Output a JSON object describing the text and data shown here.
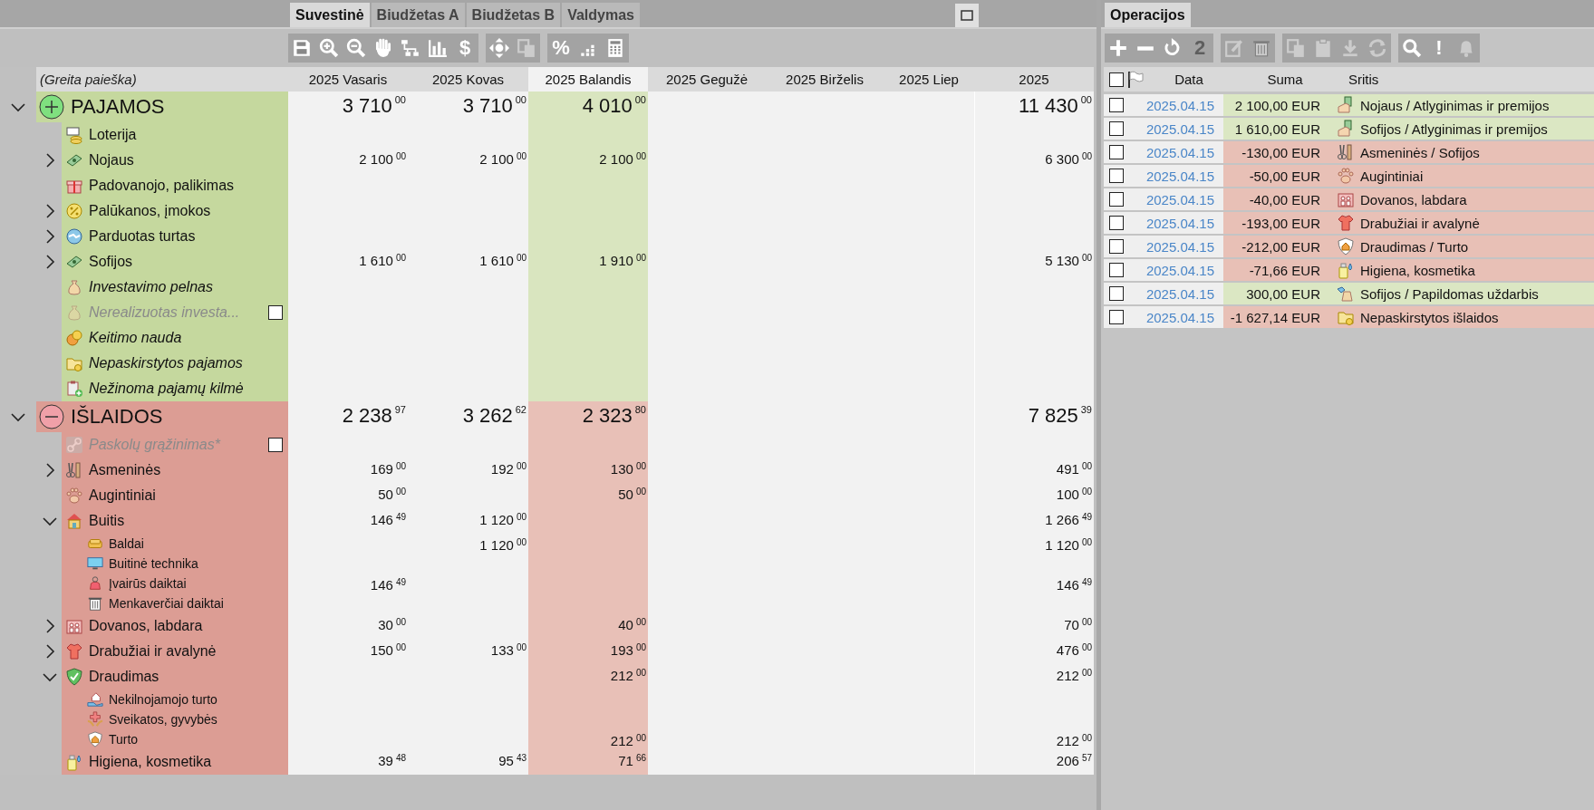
{
  "left_tabs": [
    {
      "label": "Suvestinė",
      "selected": true
    },
    {
      "label": "Biudžetas A",
      "selected": false
    },
    {
      "label": "Biudžetas B",
      "selected": false
    },
    {
      "label": "Valdymas",
      "selected": false
    }
  ],
  "toolbar": [
    [
      {
        "disabled": false
      },
      {
        "disabled": false
      },
      {
        "disabled": false
      },
      {
        "disabled": false
      },
      {
        "disabled": false
      },
      {
        "disabled": false
      },
      {
        "label": "$",
        "disabled": false
      }
    ],
    [
      {
        "disabled": false
      },
      {
        "disabled": true
      }
    ],
    [
      {
        "label": "%",
        "disabled": false
      },
      {
        "disabled": false
      },
      {
        "disabled": false
      }
    ]
  ],
  "tree": {
    "search": {
      "placeholder": "(Greita paieška)"
    },
    "columns": [
      {
        "label": "2025 Vasaris",
        "selected": false
      },
      {
        "label": "2025 Kovas",
        "selected": false
      },
      {
        "label": "2025 Balandis",
        "selected": true
      },
      {
        "label": "2025 Gegužė",
        "selected": false
      },
      {
        "label": "2025 Birželis",
        "selected": false
      },
      {
        "label": "2025 Liep",
        "selected": false
      },
      {
        "label": "2025",
        "selected": false
      }
    ],
    "sections": [
      {
        "label": "PAJAMOS",
        "kind": "income",
        "expanded": true,
        "values": {
          "vasaris": [
            "3 710",
            "00"
          ],
          "kovas": [
            "3 710",
            "00"
          ],
          "balandis": [
            "4 010",
            "00"
          ],
          "year": [
            "11 430",
            "00"
          ]
        },
        "children": [
          {
            "label": "Loterija",
            "italic": false,
            "disabled": false
          },
          {
            "label": "Nojaus",
            "expanded": false,
            "italic": false,
            "disabled": false,
            "values": {
              "vasaris": [
                "2 100",
                "00"
              ],
              "kovas": [
                "2 100",
                "00"
              ],
              "balandis": [
                "2 100",
                "00"
              ],
              "year": [
                "6 300",
                "00"
              ]
            }
          },
          {
            "label": "Padovanojo, palikimas",
            "italic": false,
            "disabled": false
          },
          {
            "label": "Palūkanos, įmokos",
            "expanded": false,
            "italic": false,
            "disabled": false
          },
          {
            "label": "Parduotas turtas",
            "expanded": false,
            "italic": false,
            "disabled": false
          },
          {
            "label": "Sofijos",
            "expanded": false,
            "italic": false,
            "disabled": false,
            "values": {
              "vasaris": [
                "1 610",
                "00"
              ],
              "kovas": [
                "1 610",
                "00"
              ],
              "balandis": [
                "1 910",
                "00"
              ],
              "year": [
                "5 130",
                "00"
              ]
            }
          },
          {
            "label": "Investavimo pelnas",
            "italic": true,
            "disabled": false
          },
          {
            "label": "Nerealizuotas investa...",
            "italic": true,
            "disabled": true,
            "checked": false
          },
          {
            "label": "Keitimo nauda",
            "italic": true,
            "disabled": false
          },
          {
            "label": "Nepaskirstytos pajamos",
            "italic": true,
            "disabled": false
          },
          {
            "label": "Nežinoma pajamų kilmė",
            "italic": true,
            "disabled": false
          }
        ]
      },
      {
        "label": "IŠLAIDOS",
        "kind": "expense",
        "expanded": true,
        "values": {
          "vasaris": [
            "2 238",
            "97"
          ],
          "kovas": [
            "3 262",
            "62"
          ],
          "balandis": [
            "2 323",
            "80"
          ],
          "year": [
            "7 825",
            "39"
          ]
        },
        "children": [
          {
            "label": "Paskolų grąžinimas*",
            "italic": true,
            "disabled": true,
            "checked": false
          },
          {
            "label": "Asmeninės",
            "expanded": false,
            "italic": false,
            "disabled": false,
            "values": {
              "vasaris": [
                "169",
                "00"
              ],
              "kovas": [
                "192",
                "00"
              ],
              "balandis": [
                "130",
                "00"
              ],
              "year": [
                "491",
                "00"
              ]
            }
          },
          {
            "label": "Augintiniai",
            "italic": false,
            "disabled": false,
            "values": {
              "vasaris": [
                "50",
                "00"
              ],
              "balandis": [
                "50",
                "00"
              ],
              "year": [
                "100",
                "00"
              ]
            }
          },
          {
            "label": "Buitis",
            "expanded": true,
            "italic": false,
            "disabled": false,
            "values": {
              "vasaris": [
                "146",
                "49"
              ],
              "kovas": [
                "1 120",
                "00"
              ],
              "year": [
                "1 266",
                "49"
              ]
            },
            "children": [
              {
                "label": "Baldai",
                "values": {
                  "kovas": [
                    "1 120",
                    "00"
                  ],
                  "year": [
                    "1 120",
                    "00"
                  ]
                }
              },
              {
                "label": "Buitinė technika"
              },
              {
                "label": "Įvairūs daiktai",
                "values": {
                  "vasaris": [
                    "146",
                    "49"
                  ],
                  "year": [
                    "146",
                    "49"
                  ]
                }
              },
              {
                "label": "Menkaverčiai daiktai"
              }
            ]
          },
          {
            "label": "Dovanos, labdara",
            "expanded": false,
            "italic": false,
            "disabled": false,
            "values": {
              "vasaris": [
                "30",
                "00"
              ],
              "balandis": [
                "40",
                "00"
              ],
              "year": [
                "70",
                "00"
              ]
            }
          },
          {
            "label": "Drabužiai ir avalynė",
            "expanded": false,
            "italic": false,
            "disabled": false,
            "values": {
              "vasaris": [
                "150",
                "00"
              ],
              "kovas": [
                "133",
                "00"
              ],
              "balandis": [
                "193",
                "00"
              ],
              "year": [
                "476",
                "00"
              ]
            }
          },
          {
            "label": "Draudimas",
            "expanded": true,
            "italic": false,
            "disabled": false,
            "values": {
              "balandis": [
                "212",
                "00"
              ],
              "year": [
                "212",
                "00"
              ]
            },
            "children": [
              {
                "label": "Nekilnojamojo turto"
              },
              {
                "label": "Sveikatos, gyvybės"
              },
              {
                "label": "Turto",
                "values": {
                  "balandis": [
                    "212",
                    "00"
                  ],
                  "year": [
                    "212",
                    "00"
                  ]
                }
              }
            ]
          },
          {
            "label": "Higiena, kosmetika",
            "italic": false,
            "disabled": false,
            "values": {
              "vasaris": [
                "39",
                "48"
              ],
              "kovas": [
                "95",
                "43"
              ],
              "balandis": [
                "71",
                "66"
              ],
              "year": [
                "206",
                "57"
              ]
            }
          }
        ]
      }
    ]
  },
  "operations": {
    "tab": "Operacijos",
    "toolbar": [
      [
        {
          "disabled": false
        },
        {
          "disabled": false
        },
        {
          "disabled": false
        },
        {
          "label": "2",
          "disabled": true
        }
      ],
      [
        {
          "disabled": true
        },
        {
          "disabled": true
        }
      ],
      [
        {
          "disabled": true
        },
        {
          "disabled": true
        },
        {
          "disabled": true
        },
        {
          "disabled": true
        }
      ],
      [
        {
          "disabled": false
        },
        {
          "label": "!",
          "disabled": false
        },
        {
          "disabled": true
        }
      ]
    ],
    "select_all": {
      "checked": false
    },
    "columns": [
      "Data",
      "Suma",
      "Sritis"
    ],
    "rows": [
      {
        "checked": false,
        "date": "2025.04.15",
        "amount": "2 100,00 EUR",
        "kind": "income",
        "category": "Nojaus / Atlyginimas ir premijos"
      },
      {
        "checked": false,
        "date": "2025.04.15",
        "amount": "1 610,00 EUR",
        "kind": "income",
        "category": "Sofijos / Atlyginimas ir premijos"
      },
      {
        "checked": false,
        "date": "2025.04.15",
        "amount": "-130,00 EUR",
        "kind": "expense",
        "category": "Asmeninės / Sofijos"
      },
      {
        "checked": false,
        "date": "2025.04.15",
        "amount": "-50,00 EUR",
        "kind": "expense",
        "category": "Augintiniai"
      },
      {
        "checked": false,
        "date": "2025.04.15",
        "amount": "-40,00 EUR",
        "kind": "expense",
        "category": "Dovanos, labdara"
      },
      {
        "checked": false,
        "date": "2025.04.15",
        "amount": "-193,00 EUR",
        "kind": "expense",
        "category": "Drabužiai ir avalynė"
      },
      {
        "checked": false,
        "date": "2025.04.15",
        "amount": "-212,00 EUR",
        "kind": "expense",
        "category": "Draudimas / Turto"
      },
      {
        "checked": false,
        "date": "2025.04.15",
        "amount": "-71,66 EUR",
        "kind": "expense",
        "category": "Higiena, kosmetika"
      },
      {
        "checked": false,
        "date": "2025.04.15",
        "amount": "300,00 EUR",
        "kind": "income",
        "category": "Sofijos / Papildomas uždarbis"
      },
      {
        "checked": false,
        "date": "2025.04.15",
        "amount": "-1 627,14 EUR",
        "kind": "expense",
        "category": "Nepaskirstytos išlaidos"
      }
    ]
  }
}
